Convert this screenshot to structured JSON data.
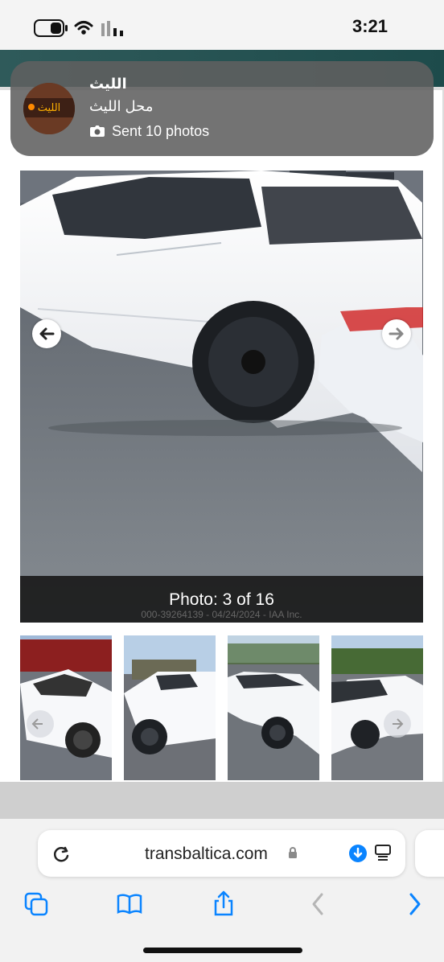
{
  "status_bar": {
    "time": "3:21"
  },
  "notification": {
    "sender": "الليث",
    "group": "محل الليث",
    "body": "Sent 10 photos",
    "avatar_text": "الليث",
    "icon": "camera-icon"
  },
  "gallery": {
    "caption": "Photo: 3 of 16",
    "watermark": "000-39264139 - 04/24/2024 - IAA Inc."
  },
  "browser": {
    "url": "transbaltica.com",
    "lock_icon": "lock-icon",
    "download_icon": "download-icon",
    "reader_icon": "reader-icon",
    "refresh_icon": "refresh-icon",
    "toolbar": {
      "tabs_icon": "tabs-icon",
      "bookmarks_icon": "bookmarks-icon",
      "share_icon": "share-icon",
      "back_icon": "back-icon",
      "forward_icon": "forward-icon"
    }
  },
  "colors": {
    "accent": "#0a84ff",
    "notification_bg": "#606060",
    "caption_bg": "#141414",
    "header_strip": "#2f5a5a"
  }
}
